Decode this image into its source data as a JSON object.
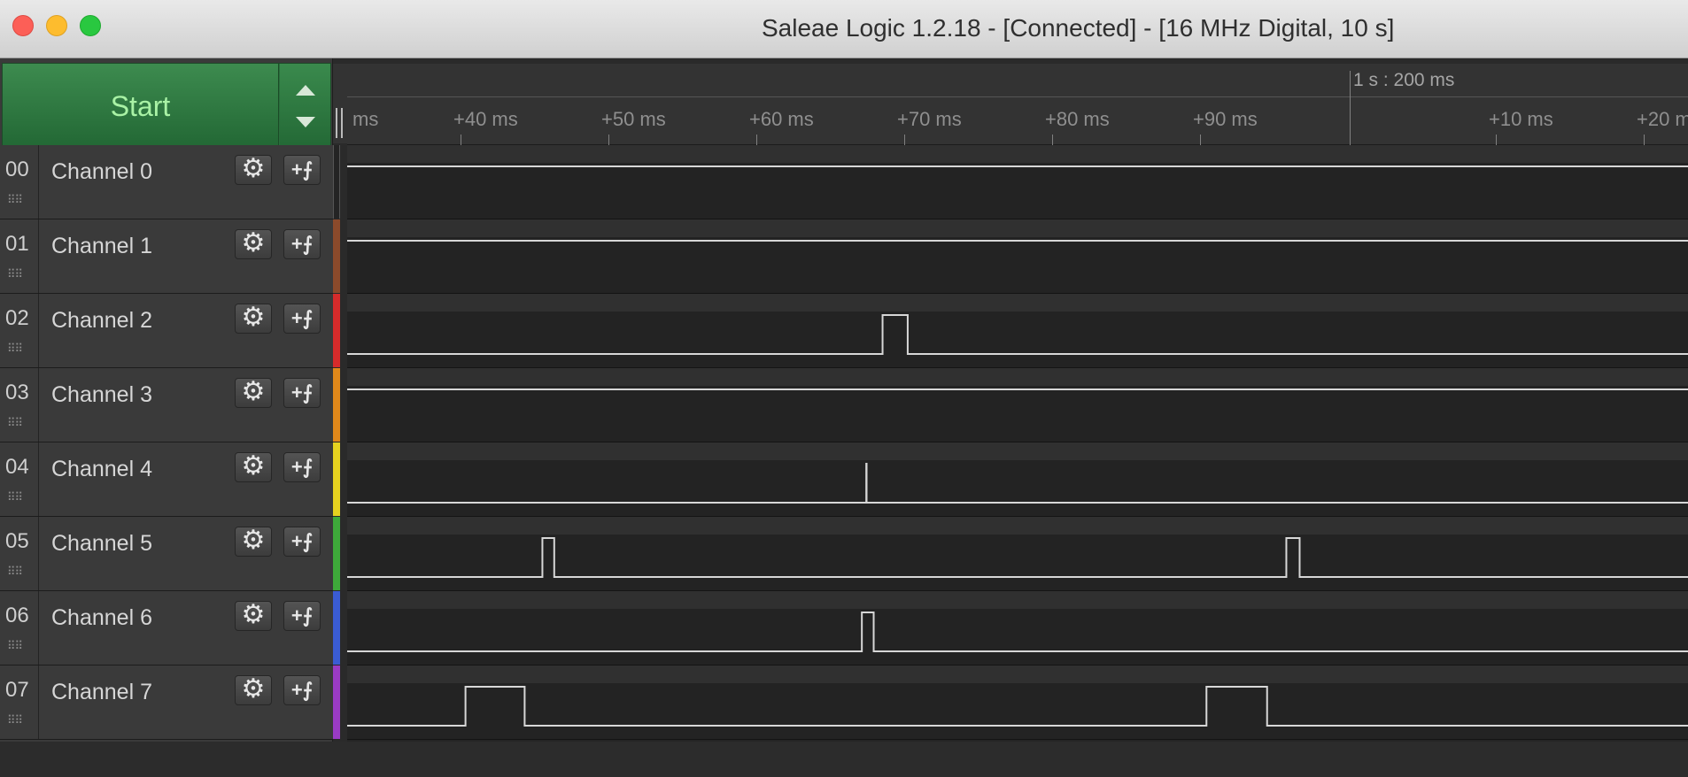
{
  "window": {
    "title": "Saleae Logic 1.2.18 - [Connected] - [16 MHz Digital, 10 s]"
  },
  "capture": {
    "start_label": "Start"
  },
  "icons": {
    "settings": "⚙",
    "trigger": "+⨍",
    "grip": "⠿⠿"
  },
  "ruler": {
    "major_label": "1 s : 200 ms",
    "ticks": [
      "ms",
      "+40 ms",
      "+50 ms",
      "+60 ms",
      "+70 ms",
      "+80 ms",
      "+90 ms",
      "+10 ms",
      "+20 ms"
    ]
  },
  "channels": [
    {
      "num": "00",
      "name": "Channel 0",
      "color": "#2a2a2a",
      "edges": [],
      "initial": "high"
    },
    {
      "num": "01",
      "name": "Channel 1",
      "color": "#8b4a2b",
      "edges": [],
      "initial": "high"
    },
    {
      "num": "02",
      "name": "Channel 2",
      "color": "#d62b2b",
      "edges": [
        [
          72.5,
          74.2
        ]
      ],
      "initial": "low"
    },
    {
      "num": "03",
      "name": "Channel 3",
      "color": "#e0881a",
      "edges": [],
      "initial": "high"
    },
    {
      "num": "04",
      "name": "Channel 4",
      "color": "#e6d21f",
      "edges": [
        [
          71.4,
          71.42
        ]
      ],
      "initial": "low"
    },
    {
      "num": "05",
      "name": "Channel 5",
      "color": "#3eaa3a",
      "edges": [
        [
          49.5,
          50.3
        ],
        [
          99.8,
          100.7
        ]
      ],
      "initial": "low"
    },
    {
      "num": "06",
      "name": "Channel 6",
      "color": "#3a5cd4",
      "edges": [
        [
          71.1,
          71.9
        ]
      ],
      "initial": "low"
    },
    {
      "num": "07",
      "name": "Channel 7",
      "color": "#9a3bc4",
      "edges": [
        [
          44.3,
          48.3
        ],
        [
          94.4,
          98.5
        ]
      ],
      "initial": "low"
    }
  ]
}
